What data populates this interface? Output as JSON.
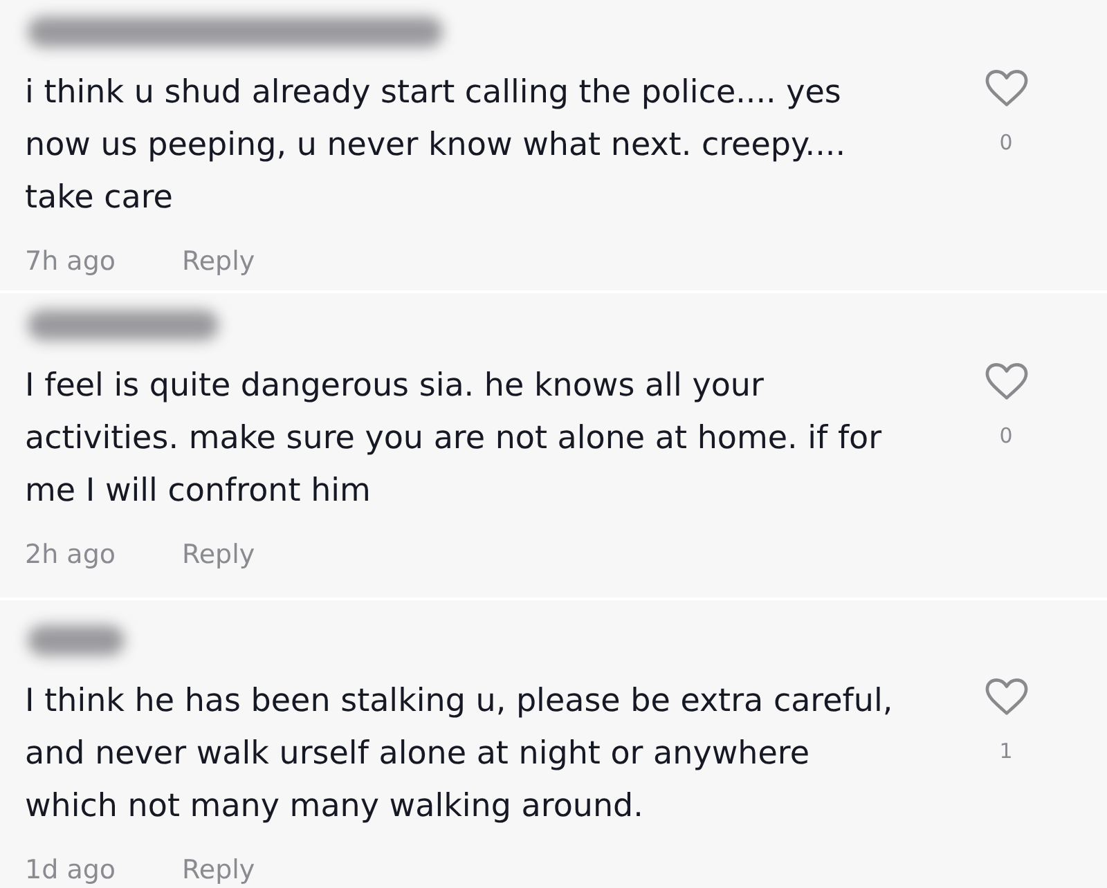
{
  "comments": [
    {
      "text": "i think u shud already start calling the police.... yes now us peeping, u never know what next. creepy.... take care",
      "time": "7h ago",
      "reply": "Reply",
      "likes": "0"
    },
    {
      "text": "I feel is quite dangerous sia. he knows all your activities. make sure you are not alone at home. if for me I will confront him",
      "time": "2h ago",
      "reply": "Reply",
      "likes": "0"
    },
    {
      "text": "I think he has been stalking u, please be extra careful, and never walk urself alone at night or anywhere which not many many walking around.",
      "time": "1d ago",
      "reply": "Reply",
      "likes": "1"
    }
  ]
}
